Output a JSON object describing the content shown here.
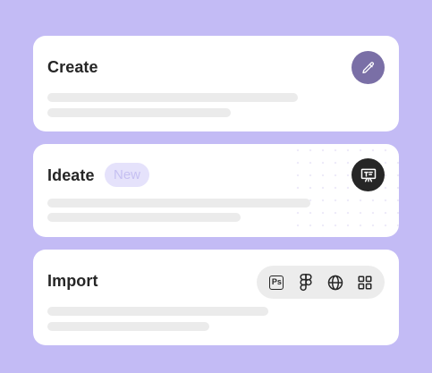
{
  "cards": {
    "create": {
      "title": "Create",
      "action_icon": "pencil-icon"
    },
    "ideate": {
      "title": "Ideate",
      "badge": "New",
      "action_icon": "presentation-board-icon"
    },
    "import": {
      "title": "Import",
      "sources": [
        {
          "icon": "photoshop-icon",
          "text": "Ps"
        },
        {
          "icon": "figma-icon"
        },
        {
          "icon": "globe-icon"
        },
        {
          "icon": "grid-apps-icon"
        }
      ]
    }
  },
  "colors": {
    "background": "#c3bbf5",
    "card": "#ffffff",
    "skeleton": "#ebebeb",
    "accent_purple": "#7a6fa6",
    "dark": "#262626",
    "badge_bg": "#e5e2fb",
    "badge_text": "#c6c0f2"
  }
}
